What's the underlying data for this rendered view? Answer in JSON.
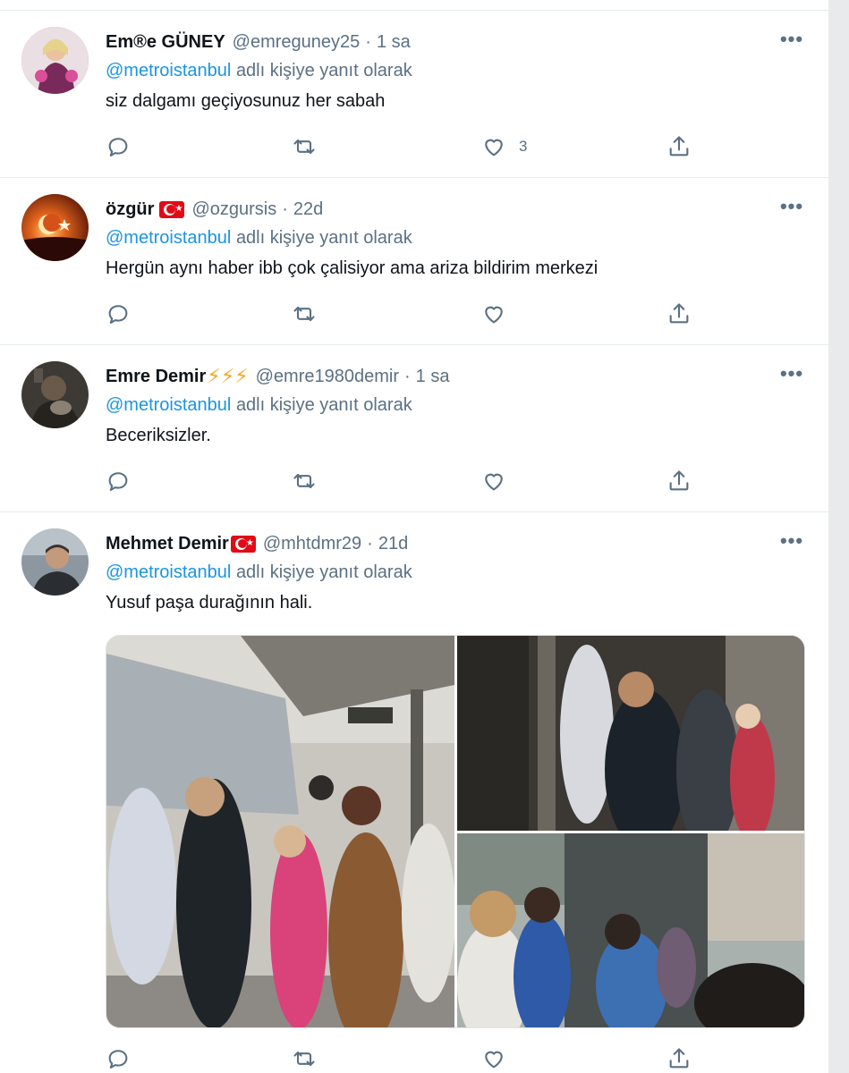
{
  "tweets": [
    {
      "name": "Em®e GÜNEY",
      "handle": "@emreguney25",
      "sep": "·",
      "time": "1 sa",
      "reply_mention": "@metroistanbul",
      "reply_suffix": "adlı kişiye yanıt olarak",
      "text": "siz dalgamı geçiyosunuz her sabah",
      "like_count": "3"
    },
    {
      "name": "özgür",
      "handle": "@ozgursis",
      "sep": "·",
      "time": "22d",
      "reply_mention": "@metroistanbul",
      "reply_suffix": "adlı kişiye yanıt olarak",
      "text": "Hergün aynı haber ibb çok çalisiyor ama ariza bildirim merkezi",
      "like_count": ""
    },
    {
      "name": "Emre Demir",
      "name_emoji": "⚡⚡⚡",
      "handle": "@emre1980demir",
      "sep": "·",
      "time": "1 sa",
      "reply_mention": "@metroistanbul",
      "reply_suffix": "adlı kişiye yanıt olarak",
      "text": "Beceriksizler.",
      "like_count": ""
    },
    {
      "name": "Mehmet Demir",
      "handle": "@mhtdmr29",
      "sep": "·",
      "time": "21d",
      "reply_mention": "@metroistanbul",
      "reply_suffix": "adlı kişiye yanıt olarak",
      "text": "Yusuf paşa durağının hali.",
      "like_count": ""
    }
  ],
  "more_label": "•••",
  "icons": {
    "reply": "reply-icon",
    "retweet": "retweet-icon",
    "like": "heart-icon",
    "share": "share-icon",
    "more": "more-icon",
    "flag": "turkey-flag-icon"
  },
  "colors": {
    "accent": "#1b95e0",
    "secondary_text": "#5b7083",
    "primary_text": "#0f1419",
    "border": "#e6ecf0"
  }
}
